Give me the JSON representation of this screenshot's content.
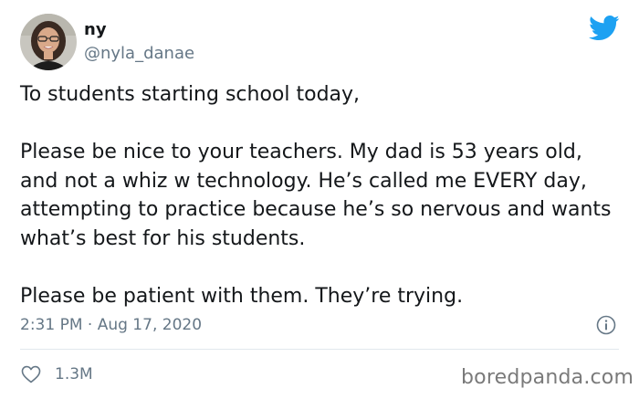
{
  "author": {
    "name": "ny",
    "handle": "@nyla_danae"
  },
  "tweet": {
    "text": "To students starting school today,\n\nPlease be nice to your teachers. My dad is 53 years old, and not a whiz w technology. He’s called me EVERY day, attempting to practice because he’s so nervous and wants what’s best for his students.\n\nPlease be patient with them. They’re trying.",
    "timestamp": "2:31 PM · Aug 17, 2020",
    "like_count": "1.3M"
  },
  "watermark": "boredpanda.com",
  "icons": {
    "brand": "twitter-bird-icon",
    "info": "info-icon",
    "like": "heart-icon"
  },
  "colors": {
    "twitter_blue": "#1da1f2",
    "text_primary": "#14171a",
    "text_secondary": "#657786",
    "divider": "#e1e8ed"
  }
}
